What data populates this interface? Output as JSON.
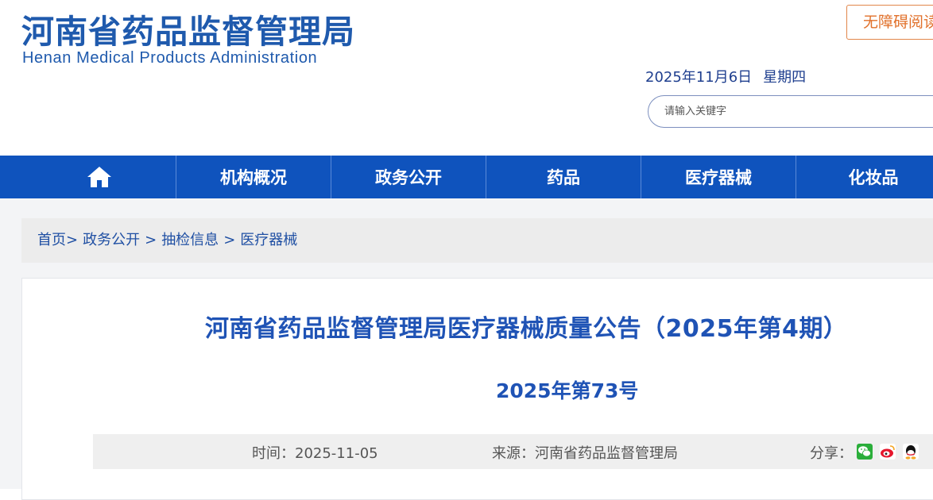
{
  "header": {
    "logo_cn": "河南省药品监督管理局",
    "logo_en": "Henan Medical Products Administration",
    "accessibility_label": "无障碍阅读",
    "date": "2025年11月6日",
    "weekday": "星期四",
    "search_placeholder": "请输入关键字"
  },
  "nav": {
    "home_icon": "home-icon",
    "items": [
      {
        "label": "机构概况"
      },
      {
        "label": "政务公开"
      },
      {
        "label": "药品"
      },
      {
        "label": "医疗器械"
      },
      {
        "label": "化妆品"
      }
    ]
  },
  "breadcrumb": {
    "items": [
      "首页",
      "政务公开",
      "抽检信息",
      "医疗器械"
    ]
  },
  "article": {
    "title": "河南省药品监督管理局医疗器械质量公告（2025年第4期）",
    "doc_number": "2025年第73号",
    "time_label": "时间：",
    "time_value": "2025-11-05",
    "source_label": "来源：",
    "source_value": "河南省药品监督管理局",
    "share_label": "分享：",
    "share_icons": [
      "wechat-icon",
      "weibo-icon",
      "qq-icon"
    ]
  },
  "colors": {
    "brand_blue": "#0f53bd",
    "title_blue": "#1f53b5",
    "accent_orange": "#e1702a"
  }
}
